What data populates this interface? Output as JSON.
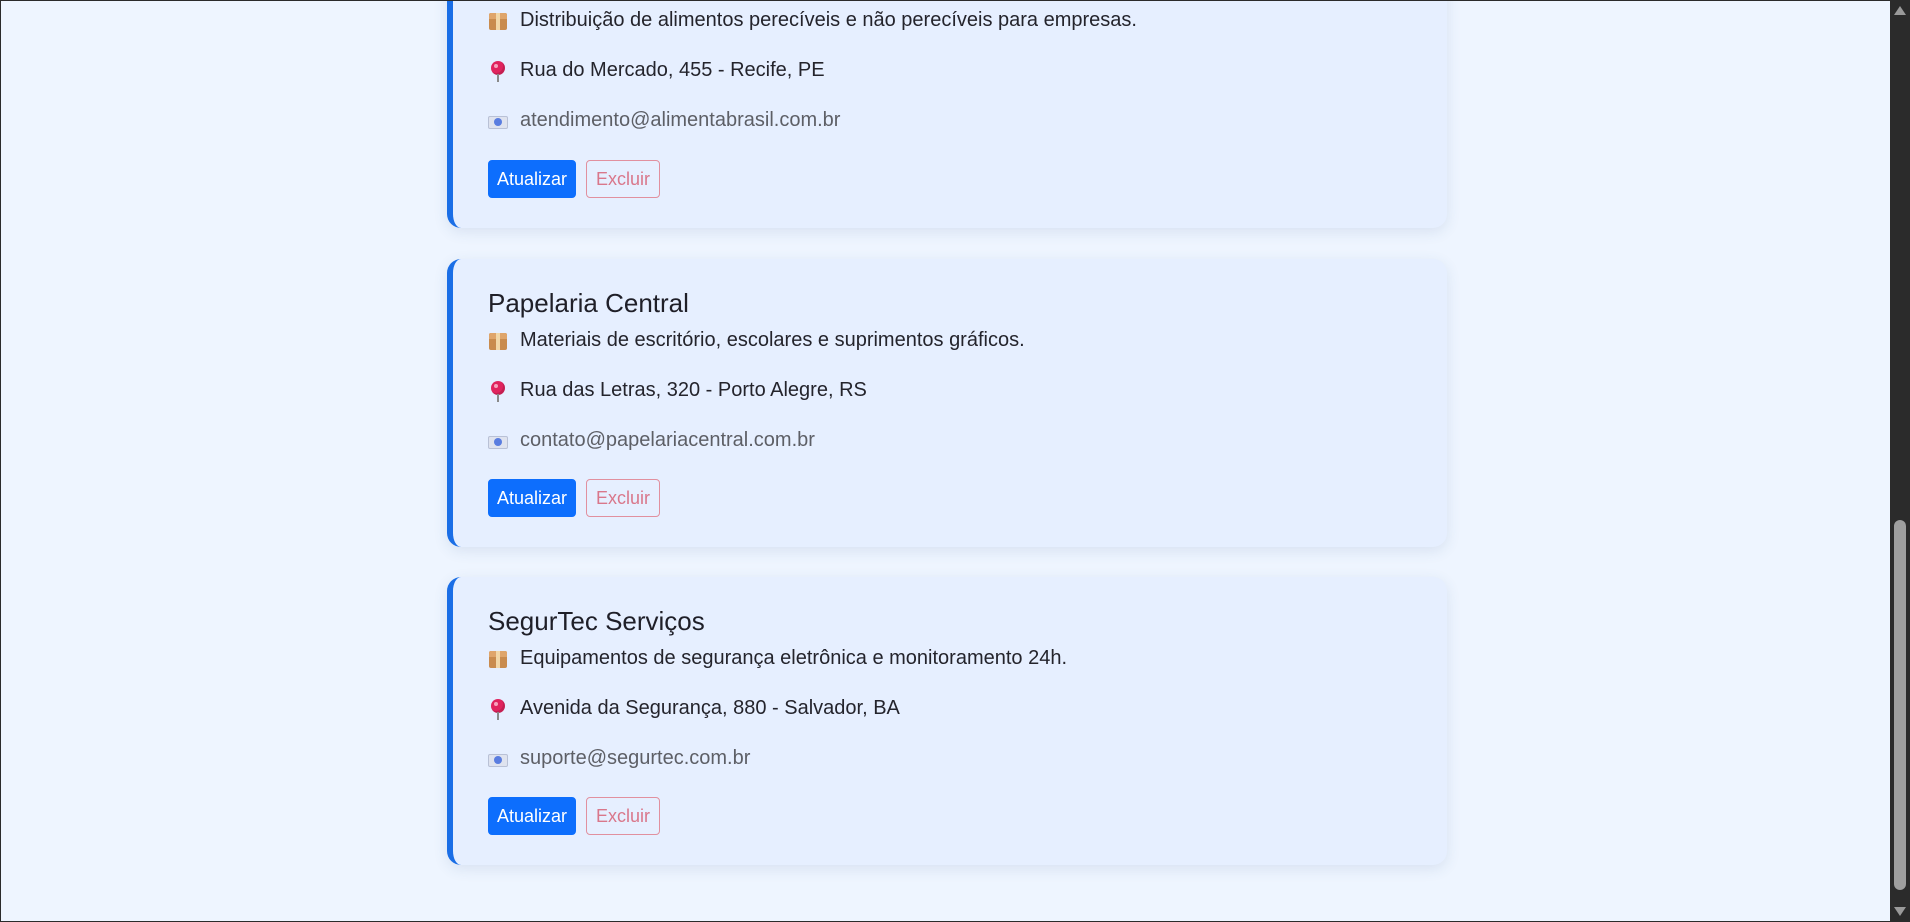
{
  "suppliers": [
    {
      "name": "",
      "description": "Distribuição de alimentos perecíveis e não perecíveis para empresas.",
      "address": "Rua do Mercado, 455 - Recife, PE",
      "email": "atendimento@alimentabrasil.com.br",
      "update_label": "Atualizar",
      "delete_label": "Excluir"
    },
    {
      "name": "Papelaria Central",
      "description": "Materiais de escritório, escolares e suprimentos gráficos.",
      "address": "Rua das Letras, 320 - Porto Alegre, RS",
      "email": "contato@papelariacentral.com.br",
      "update_label": "Atualizar",
      "delete_label": "Excluir"
    },
    {
      "name": "SegurTec Serviços",
      "description": "Equipamentos de segurança eletrônica e monitoramento 24h.",
      "address": "Avenida da Segurança, 880 - Salvador, BA",
      "email": "suporte@segurtec.com.br",
      "update_label": "Atualizar",
      "delete_label": "Excluir"
    }
  ],
  "icons": {
    "description": "package-icon",
    "address": "round-pushpin-icon",
    "email": "email-icon"
  },
  "colors": {
    "background": "#eef5ff",
    "card_background": "#e6efff",
    "card_accent": "#1a6ee6",
    "update_button": "#0d6efd",
    "delete_button_text": "#d9778b"
  }
}
